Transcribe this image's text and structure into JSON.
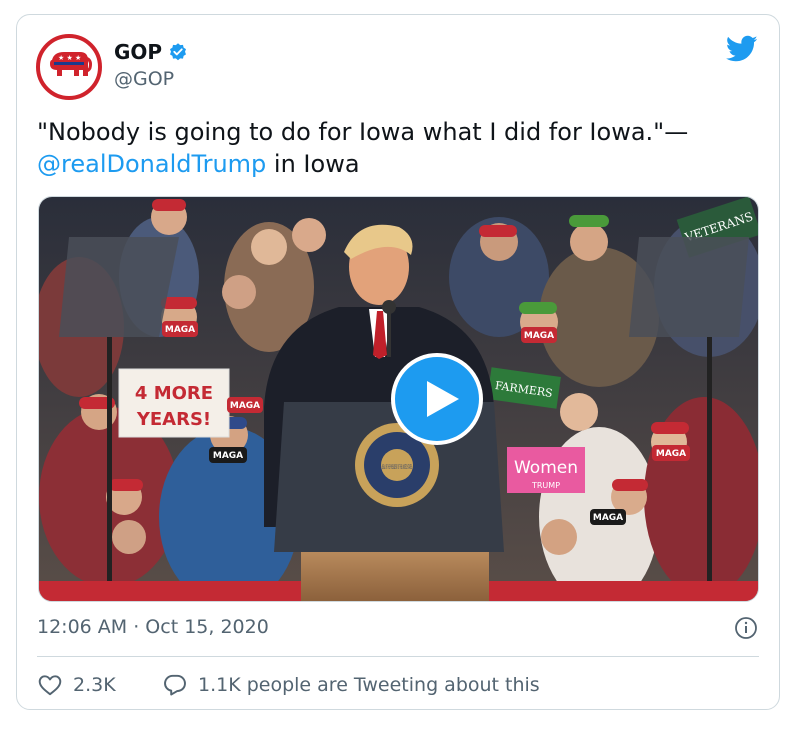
{
  "account": {
    "name": "GOP",
    "handle": "@GOP"
  },
  "tweet": {
    "text_pre": "\"Nobody is going to do for Iowa what I did for Iowa.\"—",
    "mention": "@realDonaldTrump",
    "text_post": " in Iowa"
  },
  "media": {
    "signs": {
      "four_more_years_line1": "4 MORE",
      "four_more_years_line2": "YEARS!",
      "maga": "MAGA",
      "women": "Women",
      "women_sub": "TRUMP",
      "farmers": "FARMERS",
      "veterans": "VETERANS",
      "president": "PRESIDENT",
      "seal": "SEAL OF THE PRESIDENT OF THE UNITED STATES"
    }
  },
  "meta": {
    "timestamp": "12:06 AM · Oct 15, 2020"
  },
  "actions": {
    "likes": "2.3K",
    "tweeting": "1.1K people are Tweeting about this"
  },
  "colors": {
    "accent": "#1d9bf0",
    "gop_red": "#d0232c",
    "muted": "#536471",
    "border": "#cfd9de"
  }
}
